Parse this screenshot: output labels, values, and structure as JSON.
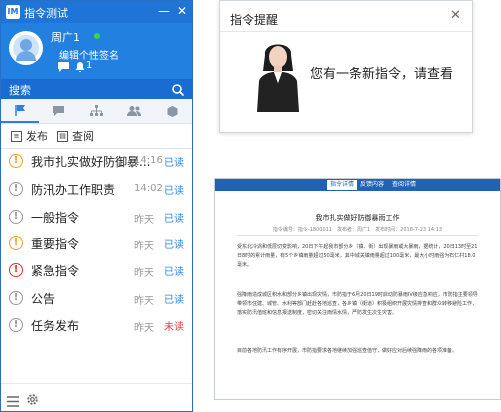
{
  "im": {
    "title": "指令测试",
    "username": "周广1",
    "signature": "编辑个性签名",
    "alert_count": "1",
    "search_placeholder": "搜索",
    "subtabs": [
      "发布",
      "查阅"
    ],
    "items": [
      {
        "title": "我市扎实做好防御暴...",
        "time": "14:16",
        "status": "已读",
        "icon": "orange"
      },
      {
        "title": "防汛办工作职责",
        "time": "14:02",
        "status": "已读",
        "icon": "gray"
      },
      {
        "title": "一般指令",
        "time": "昨天",
        "status": "已读",
        "icon": "gray"
      },
      {
        "title": "重要指令",
        "time": "昨天",
        "status": "已读",
        "icon": "orange"
      },
      {
        "title": "紧急指令",
        "time": "昨天",
        "status": "已读",
        "icon": "red"
      },
      {
        "title": "公告",
        "time": "昨天",
        "status": "已读",
        "icon": "gray"
      },
      {
        "title": "任务发布",
        "time": "昨天",
        "status": "未读",
        "icon": "gray"
      }
    ]
  },
  "popup": {
    "title": "指令提醒",
    "message": "您有一条新指令，请查看"
  },
  "document": {
    "toolbar": [
      "指令详情",
      "反馈内容",
      "查阅详情"
    ],
    "title": "我市扎实做好防御暴雨工作",
    "meta": "指令编号：指令-1800011　发布者：周广1　发布时间：2018-7-23 14:13",
    "paragraphs": [
      "受东北冷涡和低层切变影响，20日下午起我市部分乡（镇、街）出现暴雨或大暴雨，据统计，20日13时至21日8时的累计雨量，有5个乡镇雨量超过50毫米，其中城关镇雨量超过100毫米，最大小时雨强为石仁村18.0毫米。",
      "强降雨造成城区积水和部分乡镇出现灾情，市防指于6月20日19时启动防暴雨IV级应急响应，市防指主要领导带领市住建、城管、水利等部门赶赴各地巡查，各乡镇（街道）积极组织开展灾情排查和群众转移避险工作，落实防汛值班和信息报送制度，密切关注雨情水情，严防发生次生灾害。",
      "目前各地防汛工作有序开展，市防指要求各地继续加强巡查值守，做好应对后续强降雨的各项准备。"
    ]
  },
  "colors": {
    "brand_blue": "#2280e0",
    "read_status": "#2e86e6",
    "unread_status": "#e23d3d",
    "icon_orange": "#f0a028",
    "icon_red": "#e03030",
    "icon_gray": "#9a9a9a"
  },
  "icons": {
    "app_logo": "IM",
    "minimize": "—",
    "close": "✕",
    "popup_close": "✕",
    "message_icon": "speech-bubble",
    "alert_icon": "bell",
    "alert_row_icon": "!"
  }
}
